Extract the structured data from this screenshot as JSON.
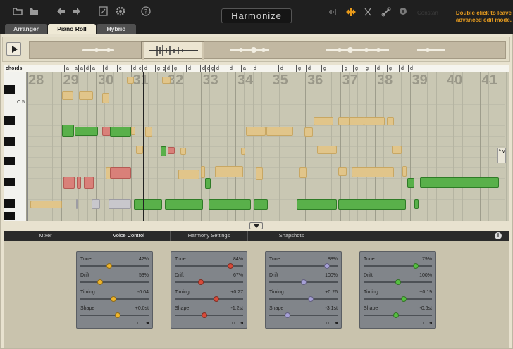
{
  "app": {
    "title": "Harmonize",
    "hint": "Double click to leave advanced edit mode.",
    "bg_text": "Constan"
  },
  "tabs": [
    {
      "label": "Arranger",
      "active": false
    },
    {
      "label": "Piano Roll",
      "active": true
    },
    {
      "label": "Hybrid",
      "active": false
    }
  ],
  "roll": {
    "chords_label": "chords",
    "chords": [
      "a",
      "a",
      "a",
      "d",
      "a",
      "d",
      "c",
      "d",
      "c",
      "d",
      "g",
      "g",
      "d",
      "g",
      "d",
      "d",
      "d",
      "g",
      "d",
      "d",
      "a",
      "d",
      "d",
      "g",
      "d",
      "g",
      "g",
      "g",
      "g",
      "d",
      "g",
      "d",
      "d"
    ],
    "measures": [
      "28",
      "29",
      "30",
      "31",
      "32",
      "33",
      "34",
      "35",
      "36",
      "37",
      "38",
      "39",
      "40",
      "41"
    ],
    "key_label": "C 5",
    "scroll_label": "^ v"
  },
  "bottom_tabs": [
    "Mixer",
    "Voice Control",
    "Harmony Settings",
    "Snapshots"
  ],
  "voices": [
    {
      "knob_color": "#f0b52a",
      "rows": [
        {
          "label": "Tune",
          "value": "42%",
          "level": 0.42
        },
        {
          "label": "Drift",
          "value": "53%",
          "level": 0.27
        },
        {
          "label": "Timing",
          "value": "-0.04",
          "level": 0.48
        },
        {
          "label": "Shape",
          "value": "+0.0st",
          "level": 0.55
        }
      ]
    },
    {
      "knob_color": "#d94b3a",
      "rows": [
        {
          "label": "Tune",
          "value": "84%",
          "level": 0.84
        },
        {
          "label": "Drift",
          "value": "67%",
          "level": 0.37
        },
        {
          "label": "Timing",
          "value": "+0.27",
          "level": 0.62
        },
        {
          "label": "Shape",
          "value": "-1.2st",
          "level": 0.43
        }
      ]
    },
    {
      "knob_color": "#a6a0d6",
      "rows": [
        {
          "label": "Tune",
          "value": "88%",
          "level": 0.88
        },
        {
          "label": "Drift",
          "value": "100%",
          "level": 0.5
        },
        {
          "label": "Timing",
          "value": "+0.26",
          "level": 0.62
        },
        {
          "label": "Shape",
          "value": "-3.1st",
          "level": 0.25
        }
      ]
    },
    {
      "knob_color": "#55c040",
      "rows": [
        {
          "label": "Tune",
          "value": "79%",
          "level": 0.79
        },
        {
          "label": "Drift",
          "value": "100%",
          "level": 0.5
        },
        {
          "label": "Timing",
          "value": "+0.19",
          "level": 0.6
        },
        {
          "label": "Shape",
          "value": "-0.6st",
          "level": 0.47
        }
      ]
    }
  ],
  "icons": [
    "folder-open-icon",
    "folder-icon",
    "undo-icon",
    "redo-icon",
    "edit-icon",
    "gear-icon",
    "help-icon",
    "waveform-icon",
    "split-icon",
    "mute-icon",
    "link-icon",
    "record-icon",
    "play-icon",
    "expand-icon",
    "info-icon",
    "headphones-icon",
    "speaker-icon"
  ]
}
